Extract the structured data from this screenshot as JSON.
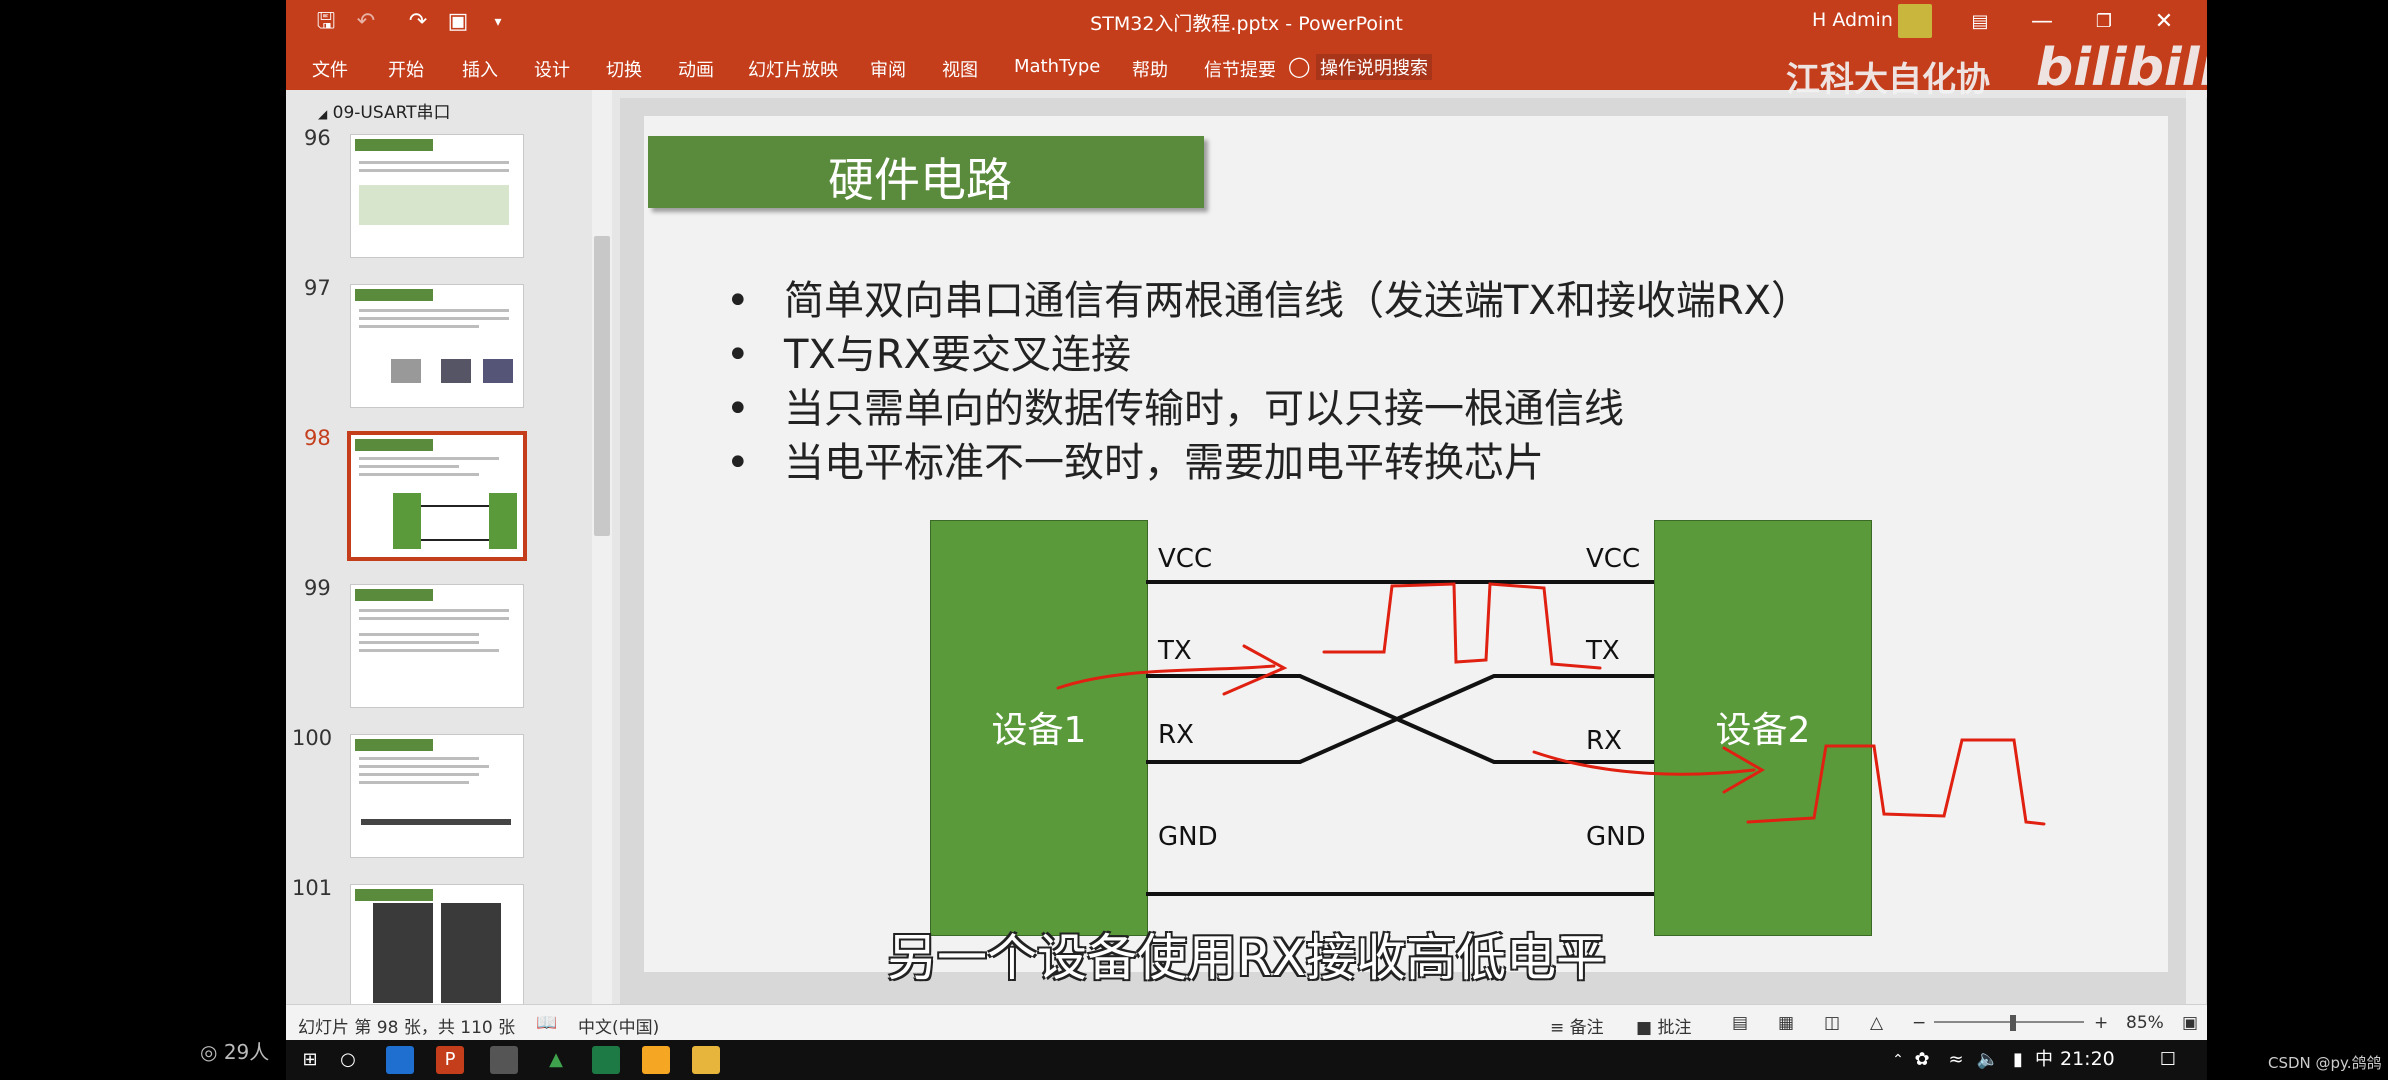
{
  "titlebar": {
    "doc_title": "STM32入门教程.pptx  -  PowerPoint",
    "user": "H Admin"
  },
  "ribbon": {
    "tabs": [
      "文件",
      "开始",
      "插入",
      "设计",
      "切换",
      "动画",
      "幻灯片放映",
      "审阅",
      "视图",
      "MathType",
      "帮助",
      "信节提要"
    ],
    "tell_me": "操作说明搜索"
  },
  "watermark": {
    "club": "江科大自化协",
    "brand": "bilibili"
  },
  "panel": {
    "section": "09-USART串口",
    "slides": [
      {
        "num": "96"
      },
      {
        "num": "97"
      },
      {
        "num": "98",
        "selected": true
      },
      {
        "num": "99"
      },
      {
        "num": "100"
      },
      {
        "num": "101"
      }
    ]
  },
  "slide": {
    "title": "硬件电路",
    "bullets": [
      "简单双向串口通信有两根通信线（发送端TX和接收端RX）",
      "TX与RX要交叉连接",
      "当只需单向的数据传输时，可以只接一根通信线",
      "当电平标准不一致时，需要加电平转换芯片"
    ],
    "device1": "设备1",
    "device2": "设备2",
    "left_signals": [
      "VCC",
      "TX",
      "RX",
      "GND"
    ],
    "right_signals": [
      "VCC",
      "TX",
      "RX",
      "GND"
    ]
  },
  "subtitle": "另一个设备使用RX接收高低电平",
  "status": {
    "slide_info": "幻灯片 第 98 张，共 110 张",
    "language": "中文(中国)",
    "notes": "备注",
    "comments": "批注",
    "zoom": "85%"
  },
  "taskbar": {
    "time": "21:20",
    "ime": "中"
  },
  "overlay": {
    "viewers": "29人",
    "csdn": "CSDN @py.鸽鸽"
  },
  "colors": {
    "accent": "#c43e1c",
    "device_green": "#5a9a3b",
    "title_green": "#5a8a3b",
    "annotation": "#e02010"
  }
}
